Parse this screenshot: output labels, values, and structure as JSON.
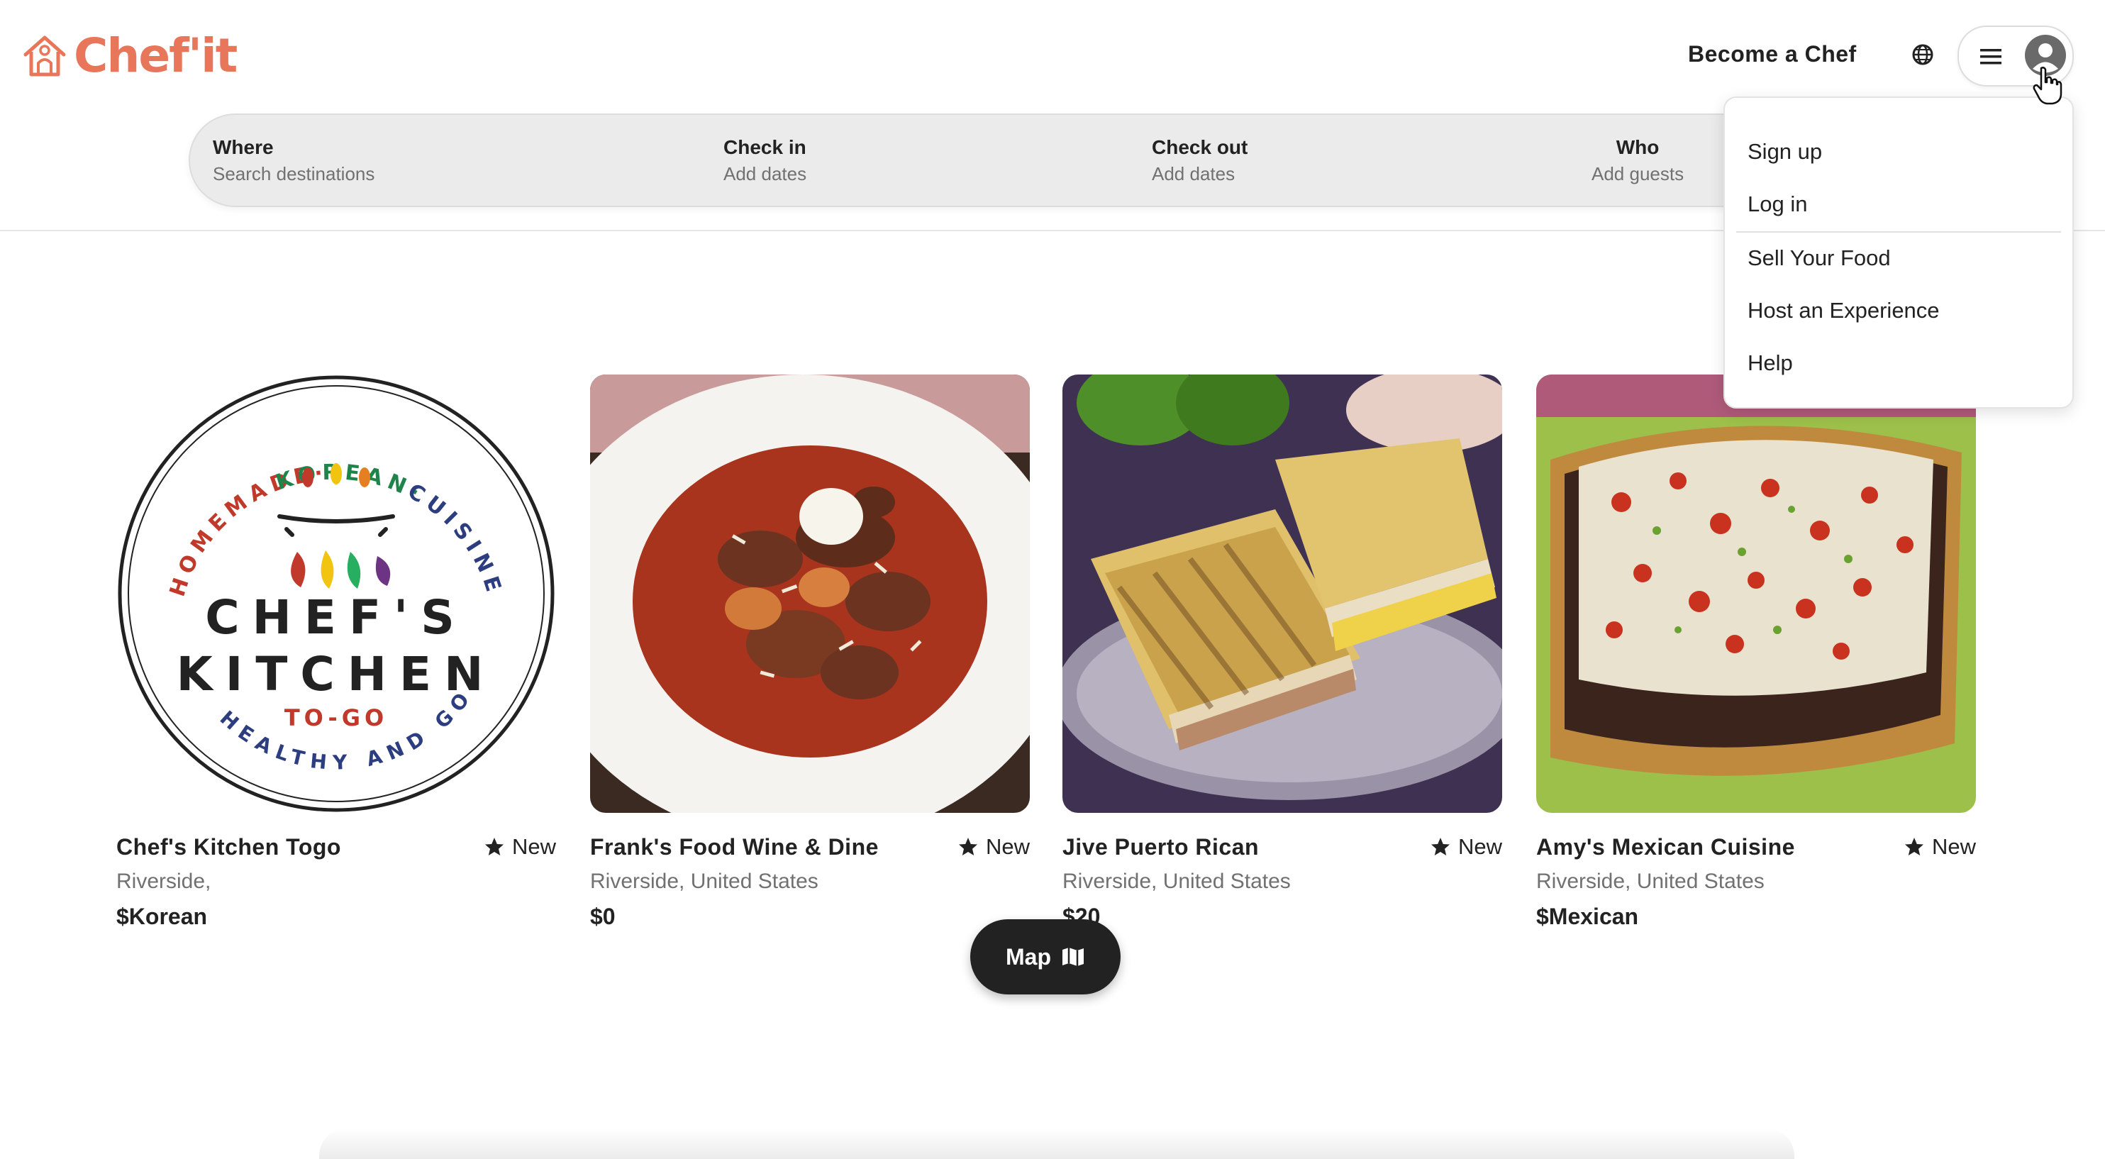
{
  "brand": {
    "name": "Chef'it",
    "logo_icon": "chef-house-icon",
    "accent": "#e8765a"
  },
  "header": {
    "become_chef": "Become a Chef",
    "globe_icon": "globe-icon",
    "menu_icon": "hamburger-icon",
    "avatar_icon": "user-avatar-icon"
  },
  "search": {
    "where_label": "Where",
    "where_placeholder": "Search destinations",
    "checkin_label": "Check in",
    "checkin_placeholder": "Add dates",
    "checkout_label": "Check out",
    "checkout_placeholder": "Add dates",
    "who_label": "Who",
    "who_placeholder": "Add guests"
  },
  "user_menu": {
    "items": [
      "Sign up",
      "Log in",
      "Sell Your Food",
      "Host an Experience",
      "Help"
    ]
  },
  "listings": [
    {
      "title": "Chef's Kitchen Togo",
      "badge": "New",
      "location": "Riverside,",
      "price": "$Korean",
      "logo_text": {
        "arc_top": "HOMEMADE·KOREAN·CUISINE",
        "line1": "CHEF'S",
        "line2": "KITCHEN",
        "line3": "TO-GO",
        "arc_bottom": "HEALTHY AND GOOD"
      }
    },
    {
      "title": "Frank's Food Wine & Dine",
      "badge": "New",
      "location": "Riverside, United States",
      "price": "$0"
    },
    {
      "title": "Jive Puerto Rican",
      "badge": "New",
      "location": "Riverside, United States",
      "price": "$20"
    },
    {
      "title": "Amy's Mexican Cuisine",
      "badge": "New",
      "location": "Riverside, United States",
      "price": "$Mexican"
    }
  ],
  "map_button": {
    "label": "Map",
    "icon": "map-icon"
  }
}
